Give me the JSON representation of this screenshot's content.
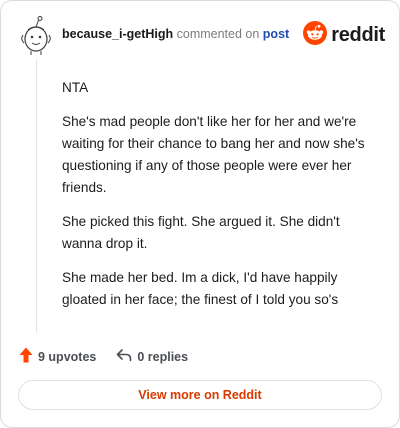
{
  "header": {
    "username": "because_i-getHigh",
    "action_text": "commented on",
    "post_link": "post",
    "brand_name": "reddit"
  },
  "comment": {
    "paragraphs": [
      "NTA",
      "She's mad people don't like her for her and we're waiting for their chance to bang her and now she's questioning if any of those people were ever her friends.",
      "She picked this fight. She argued it. She didn't wanna drop it.",
      "She made her bed. Im a dick, I'd have happily gloated in her face; the finest of I told you so's"
    ]
  },
  "footer": {
    "upvotes_label": "9 upvotes",
    "replies_label": "0 replies",
    "view_button_label": "View more on Reddit"
  },
  "colors": {
    "brand_orange": "#ff4500",
    "link_blue": "#1f4db3",
    "button_text": "#d93a00"
  },
  "icons": {
    "avatar": "snoo-avatar-icon",
    "brand": "reddit-logo-icon",
    "upvote": "upvote-arrow-icon",
    "reply": "reply-arrow-icon"
  }
}
